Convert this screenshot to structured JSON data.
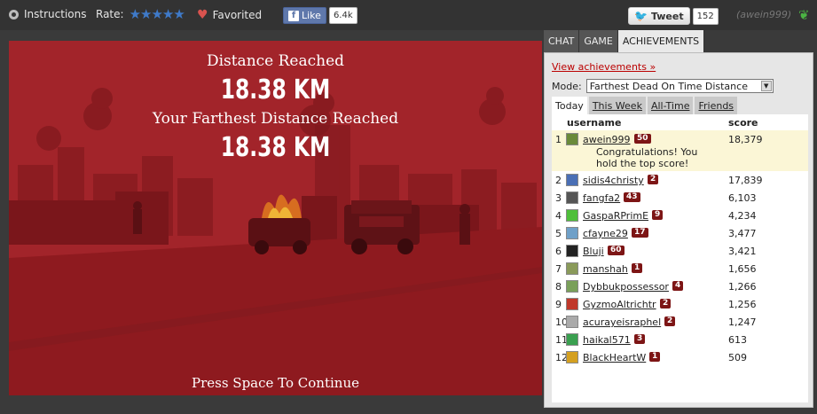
{
  "topbar": {
    "instructions_label": "Instructions",
    "rate_label": "Rate:",
    "stars": "★★★★★",
    "favorited_label": "Favorited",
    "fb_like_label": "Like",
    "fb_like_count": "6.4k",
    "tweet_label": "Tweet",
    "tweet_count": "152",
    "user_handle": "(awein999)"
  },
  "game": {
    "distance_label": "Distance Reached",
    "distance_value": "18.38 KM",
    "farthest_label": "Your Farthest Distance Reached",
    "farthest_value": "18.38 KM",
    "continue_prompt": "Press Space To Continue"
  },
  "panel": {
    "tabs": [
      {
        "label": "CHAT"
      },
      {
        "label": "GAME"
      },
      {
        "label": "ACHIEVEMENTS"
      }
    ],
    "view_achievements": "View achievements »",
    "mode_label": "Mode:",
    "mode_value": "Farthest Dead On Time Distance",
    "subtabs": [
      {
        "label": "Today"
      },
      {
        "label": "This Week"
      },
      {
        "label": "All-Time"
      },
      {
        "label": "Friends"
      }
    ],
    "col_username": "username",
    "col_score": "score",
    "congrats_line1": "Congratulations! You",
    "congrats_line2": "hold the top score!",
    "rows": [
      {
        "rank": "1",
        "username": "awein999",
        "level": "50",
        "score": "18,379",
        "avatar_color": "#6a8a3a"
      },
      {
        "rank": "2",
        "username": "sidis4christy",
        "level": "2",
        "score": "17,839",
        "avatar_color": "#4a6fb5"
      },
      {
        "rank": "3",
        "username": "fangfa2",
        "level": "43",
        "score": "6,103",
        "avatar_color": "#555555"
      },
      {
        "rank": "4",
        "username": "GaspaRPrimE",
        "level": "9",
        "score": "4,234",
        "avatar_color": "#4fbf3a"
      },
      {
        "rank": "5",
        "username": "cfayne29",
        "level": "17",
        "score": "3,477",
        "avatar_color": "#6fa0c8"
      },
      {
        "rank": "6",
        "username": "Bluji",
        "level": "60",
        "score": "3,421",
        "avatar_color": "#222222"
      },
      {
        "rank": "7",
        "username": "manshah",
        "level": "1",
        "score": "1,656",
        "avatar_color": "#8a9a5a"
      },
      {
        "rank": "8",
        "username": "Dybbukpossessor",
        "level": "4",
        "score": "1,266",
        "avatar_color": "#7aa05a"
      },
      {
        "rank": "9",
        "username": "GyzmoAltrichtr",
        "level": "2",
        "score": "1,256",
        "avatar_color": "#c0392b"
      },
      {
        "rank": "10",
        "username": "acurayeisraphel",
        "level": "2",
        "score": "1,247",
        "avatar_color": "#aaaaaa"
      },
      {
        "rank": "11",
        "username": "haikal571",
        "level": "3",
        "score": "613",
        "avatar_color": "#3aa050"
      },
      {
        "rank": "12",
        "username": "BlackHeartW",
        "level": "1",
        "score": "509",
        "avatar_color": "#d4a020"
      }
    ]
  }
}
